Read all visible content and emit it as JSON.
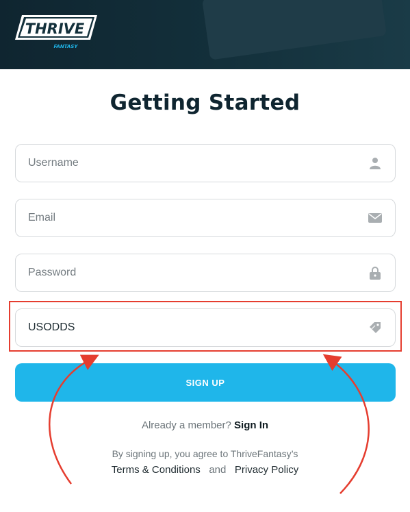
{
  "header": {
    "logo_text": "THRIVE",
    "logo_sub": "FANTASY"
  },
  "page_title": "Getting Started",
  "form": {
    "username_placeholder": "Username",
    "email_placeholder": "Email",
    "password_placeholder": "Password",
    "promo_value": "USODDS",
    "submit_label": "SIGN UP"
  },
  "footer": {
    "member_text": "Already a member?",
    "signin_label": "Sign In",
    "agree_text": "By signing up, you agree to ThriveFantasy’s",
    "terms_label": "Terms & Conditions",
    "and_text": "and",
    "privacy_label": "Privacy Policy"
  },
  "colors": {
    "header_bg": "#0f2530",
    "accent": "#1fb6ea",
    "highlight": "#e53d2f"
  },
  "icons": [
    "user-icon",
    "envelope-icon",
    "lock-icon",
    "tag-icon"
  ]
}
